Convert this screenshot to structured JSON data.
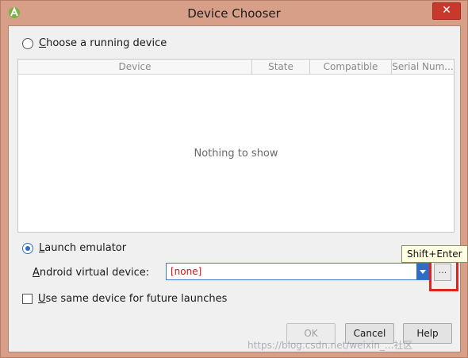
{
  "window": {
    "title": "Device Chooser",
    "close_label": "✕"
  },
  "running": {
    "radio_label_first": "C",
    "radio_label_rest": "hoose a running device",
    "checked": false
  },
  "table": {
    "columns": [
      "Device",
      "State",
      "Compatible",
      "Serial Num..."
    ],
    "empty_message": "Nothing to show"
  },
  "emulator": {
    "radio_label_first": "L",
    "radio_label_rest": "aunch emulator",
    "checked": true,
    "avd_label_first": "A",
    "avd_label_rest": "ndroid virtual device:",
    "avd_value": "[none]",
    "browse_label": "...",
    "tooltip": "Shift+Enter"
  },
  "options": {
    "same_device_label_first": "U",
    "same_device_label_rest": "se same device for future launches",
    "checked": false
  },
  "buttons": {
    "ok": "OK",
    "cancel": "Cancel",
    "help": "Help"
  },
  "watermark": "https://blog.csdn.net/weixin_...社区",
  "colors": {
    "window_frame": "#d79f87",
    "accent": "#2b6fc7",
    "highlight": "#e0231b",
    "avd_value": "#d21414"
  }
}
